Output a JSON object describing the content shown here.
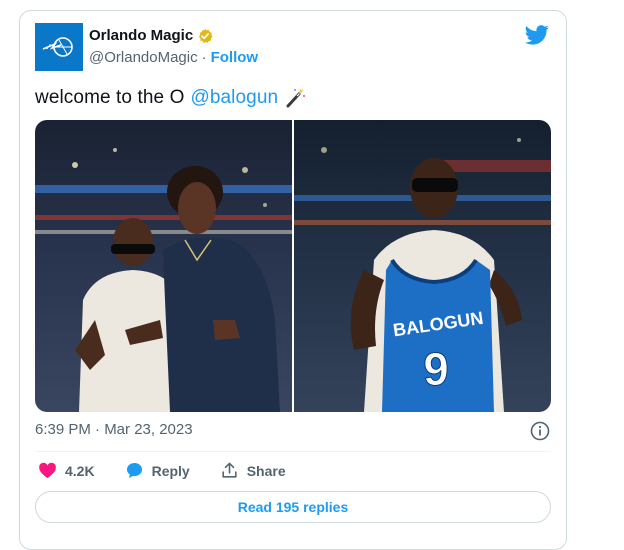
{
  "account": {
    "name": "Orlando Magic",
    "handle": "@OrlandoMagic",
    "separator": "·",
    "follow_label": "Follow",
    "verified": true
  },
  "tweet": {
    "text": "welcome to the O",
    "mention": "@balogun",
    "emoji": "magic-wand-icon"
  },
  "media": {
    "left_photo": "two-players-arena-photo",
    "right_photo": "player-holding-jersey-photo",
    "jersey_name": "BALOGUN",
    "jersey_number": "9"
  },
  "meta": {
    "timestamp": "6:39 PM · Mar 23, 2023"
  },
  "actions": {
    "likes": "4.2K",
    "reply_label": "Reply",
    "share_label": "Share"
  },
  "read_replies_label": "Read 195 replies",
  "colors": {
    "brand_blue": "#1d9bf0",
    "magic_blue": "#0b77c8",
    "like_pink": "#f91880",
    "muted": "#536471",
    "gold_badge": "#e2b719"
  }
}
